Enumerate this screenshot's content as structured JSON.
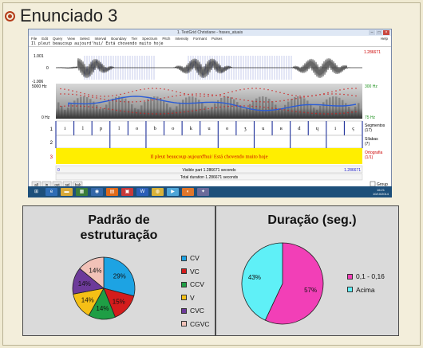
{
  "slide": {
    "title": "Enunciado 3"
  },
  "praat": {
    "window_title": "1. TextGrid Christiane - frases_atuais",
    "menu": [
      "File",
      "Edit",
      "Query",
      "View",
      "Select",
      "Interval",
      "Boundary",
      "Tier",
      "Spectrum",
      "Pitch",
      "Intensity",
      "Formant",
      "Pulses"
    ],
    "help": "Help",
    "text_line": "Il pleut beaucoup aujourd'hui/ Está chovendo muito hoje",
    "top_time": "1.286671",
    "amp_max": "1.001",
    "amp_zero": "0",
    "amp_min": "-1.006",
    "freq_max": "5000 Hz",
    "freq_min": "0 Hz",
    "pitch_max": "300 Hz",
    "pitch_min": "75 Hz",
    "tier_numbers": [
      "1",
      "2",
      "3"
    ],
    "tier1_labels": [
      "i",
      "l",
      "p",
      "l",
      "o",
      "b",
      "o",
      "k",
      "u",
      "o",
      "ʒ",
      "u",
      "ʀ",
      "d",
      "ɥ",
      "i",
      "ç"
    ],
    "tier1_name": "Segmentos",
    "tier1_count": "(17)",
    "tier2_name": "Sílabas",
    "tier2_count": "(7)",
    "tier3_text": "Il pleut beaucoup aujourd'hui/ Está chovendo muito hoje",
    "tier3_name": "Ortografia",
    "tier3_count": "(1/1)",
    "visible_left": "0",
    "visible_label": "Visible part 1.286671 seconds",
    "visible_right": "1.286671",
    "total_label": "Total duration 1.286671 seconds",
    "group_label": "Group",
    "buttons": [
      "all",
      "in",
      "out",
      "sel",
      "bak"
    ]
  },
  "taskbar": {
    "time": "16:21",
    "date": "10/10/2014"
  },
  "chart_data": [
    {
      "type": "pie",
      "title": "Padrão de estruturação",
      "categories": [
        "CV",
        "VC",
        "CCV",
        "V",
        "CVC",
        "CGVC"
      ],
      "values": [
        29,
        15,
        14,
        14,
        14,
        14
      ],
      "labels": [
        "29%",
        "15%",
        "14%",
        "14%",
        "14%",
        "14%"
      ],
      "colors": [
        "#1da3e3",
        "#d41c1c",
        "#1f9e45",
        "#f5c016",
        "#6d3a9a",
        "#f2c2b8"
      ]
    },
    {
      "type": "pie",
      "title": "Duração (seg.)",
      "categories": [
        "0,1 - 0,16",
        "Acima"
      ],
      "values": [
        57,
        43
      ],
      "labels": [
        "57%",
        "43%"
      ],
      "colors": [
        "#f23fb7",
        "#5ff0f7"
      ]
    }
  ]
}
